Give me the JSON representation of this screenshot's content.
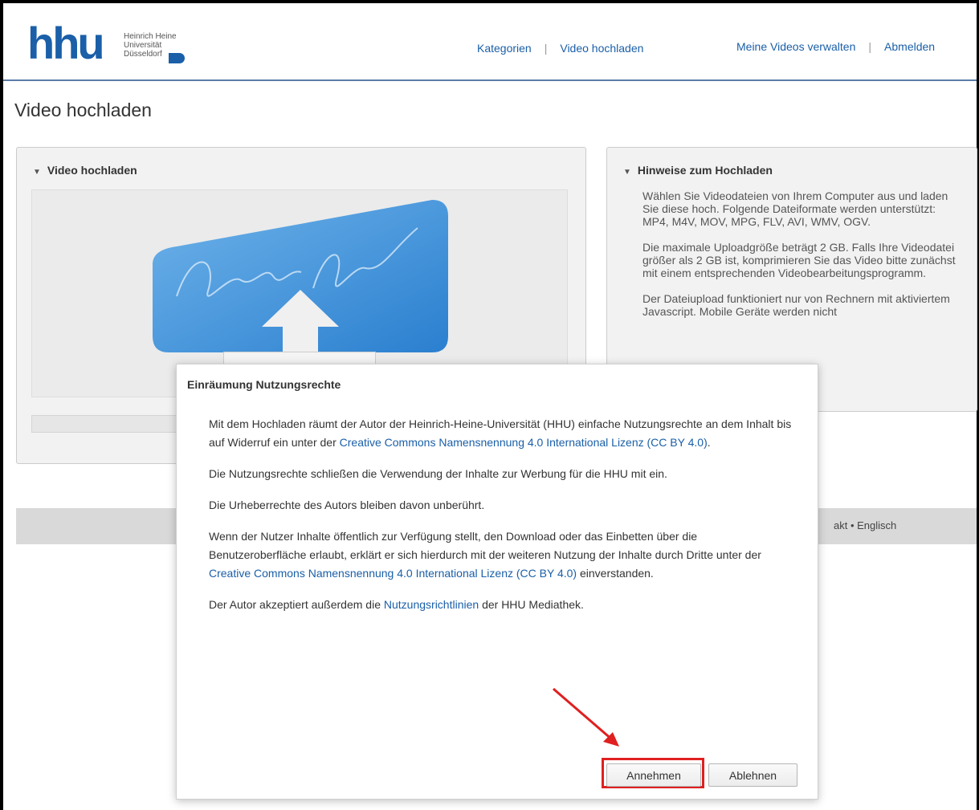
{
  "header": {
    "logo_word": "hhu",
    "logo_lines": [
      "Heinrich Heine",
      "Universität",
      "Düsseldorf"
    ],
    "nav_left": [
      "Kategorien",
      "Video hochladen"
    ],
    "nav_right": [
      "Meine Videos verwalten",
      "Abmelden"
    ],
    "nav_separator": "|"
  },
  "page": {
    "title": "Video hochladen"
  },
  "upload_panel": {
    "heading": "Video hochladen",
    "toggle_icon": "▼"
  },
  "hints_panel": {
    "heading": "Hinweise zum Hochladen",
    "toggle_icon": "▼",
    "paragraphs": [
      "Wählen Sie Videodateien von Ihrem Computer aus und laden Sie diese hoch. Folgende Dateiformate werden unterstützt: MP4, M4V, MOV, MPG, FLV, AVI, WMV, OGV.",
      "Die maximale Uploadgröße beträgt 2 GB. Falls Ihre Videodatei größer als 2 GB ist, komprimieren Sie das Video bitte zunächst mit einem entsprechenden Videobearbeitungsprogramm.",
      "Der Dateiupload funktioniert nur von Rechnern mit aktiviertem Javascript. Mobile Geräte werden nicht"
    ]
  },
  "footer": {
    "links_text": "akt • Englisch"
  },
  "dialog": {
    "title": "Einräumung Nutzungsrechte",
    "p1_before": "Mit dem Hochladen räumt der Autor der Heinrich-Heine-Universität (HHU) einfache Nutzungsrechte an dem Inhalt bis auf Widerruf ein unter der ",
    "p1_link": "Creative Commons Namensnennung 4.0 International Lizenz (CC BY 4.0)",
    "p1_after": ".",
    "p2": "Die Nutzungsrechte schließen die Verwendung der Inhalte zur Werbung für die HHU mit ein.",
    "p3": "Die Urheberrechte des Autors bleiben davon unberührt.",
    "p4_before": "Wenn der Nutzer Inhalte öffentlich zur Verfügung stellt, den Download oder das Einbetten über die Benutzeroberfläche erlaubt, erklärt er sich hierdurch mit der weiteren Nutzung der Inhalte durch Dritte unter der ",
    "p4_link": "Creative Commons Namensnennung 4.0 International Lizenz (CC BY 4.0)",
    "p4_after": " einverstanden.",
    "p5_before": "Der Autor akzeptiert außerdem die ",
    "p5_link": "Nutzungsrichtlinien",
    "p5_after": " der HHU Mediathek.",
    "accept_label": "Annehmen",
    "reject_label": "Ablehnen"
  },
  "colors": {
    "brand_blue": "#1a5fa8",
    "highlight_red": "#e02020",
    "upload_graphic_blue": "#3a8fd6"
  }
}
